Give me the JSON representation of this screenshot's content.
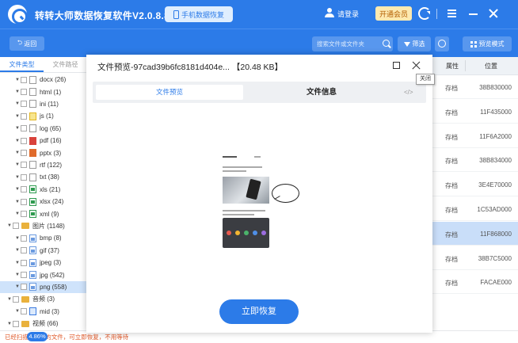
{
  "app": {
    "title": "转转大师数据恢复软件V2.0.8.8",
    "mobile_btn": "手机数据恢复",
    "login": "请登录",
    "vip": "开通会员"
  },
  "toolbar": {
    "back": "返回",
    "search_placeholder": "搜索文件或文件夹",
    "filter": "筛选",
    "preview_mode": "预览模式"
  },
  "left_panel": {
    "tabs": [
      "文件类型",
      "文件路径"
    ],
    "tree": [
      {
        "label": "docx (26)",
        "icon": "doc"
      },
      {
        "label": "html (1)",
        "icon": "doc"
      },
      {
        "label": "ini (11)",
        "icon": "doc"
      },
      {
        "label": "js (1)",
        "icon": "js"
      },
      {
        "label": "log (65)",
        "icon": "doc"
      },
      {
        "label": "pdf (16)",
        "icon": "pdf"
      },
      {
        "label": "pptx (3)",
        "icon": "ppt"
      },
      {
        "label": "rtf (122)",
        "icon": "doc"
      },
      {
        "label": "txt (38)",
        "icon": "doc"
      },
      {
        "label": "xls (21)",
        "icon": "xls"
      },
      {
        "label": "xlsx (24)",
        "icon": "xls"
      },
      {
        "label": "xml (9)",
        "icon": "xls"
      },
      {
        "label": "图片 (1148)",
        "icon": "folder"
      },
      {
        "label": "bmp (8)",
        "icon": "img"
      },
      {
        "label": "gif (37)",
        "icon": "img"
      },
      {
        "label": "jpeg (3)",
        "icon": "img"
      },
      {
        "label": "jpg (542)",
        "icon": "img"
      },
      {
        "label": "png (558)",
        "icon": "img"
      },
      {
        "label": "音频 (3)",
        "icon": "folder"
      },
      {
        "label": "mid (3)",
        "icon": "audio"
      },
      {
        "label": "视频 (66)",
        "icon": "folder"
      }
    ]
  },
  "table": {
    "headers": {
      "attr": "属性",
      "pos": "位置"
    },
    "rows": [
      {
        "attr": "存档",
        "pos": "38B830000"
      },
      {
        "attr": "存档",
        "pos": "11F435000"
      },
      {
        "attr": "存档",
        "pos": "11F6A2000"
      },
      {
        "attr": "存档",
        "pos": "38B834000"
      },
      {
        "attr": "存档",
        "pos": "3E4E70000"
      },
      {
        "attr": "存档",
        "pos": "1C53AD000"
      },
      {
        "attr": "存档",
        "pos": "11F868000"
      },
      {
        "attr": "存档",
        "pos": "38B7C5000"
      },
      {
        "attr": "存档",
        "pos": "FACAE000"
      }
    ]
  },
  "modal": {
    "title": "文件预览-97cad39b6fc8181d404e...  【20.48 KB】",
    "tooltip": "关闭",
    "tab_preview": "文件预览",
    "tab_info": "文件信息",
    "code_icon": "</>",
    "recover": "立即恢复"
  },
  "status": {
    "text": "已经扫描6.37%的文件，可立即恢复，不用等待",
    "progress": "4.86%"
  },
  "colors": {
    "accent": "#2c7be8",
    "warning": "#e05a2b"
  }
}
